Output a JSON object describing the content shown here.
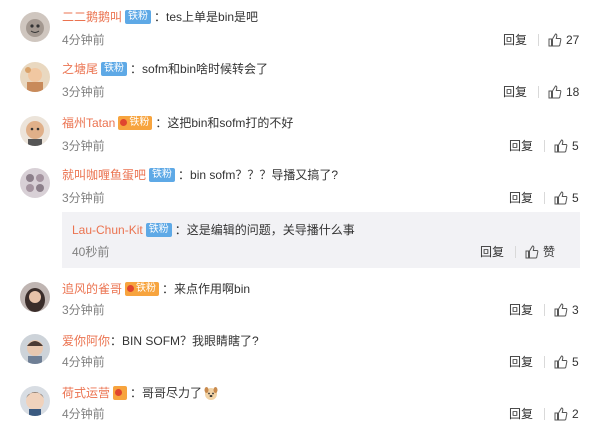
{
  "common": {
    "reply_label": "回复",
    "colon": "："
  },
  "comments": [
    {
      "username": "二二鹅鹅叫",
      "badge": "铁粉",
      "badge_type": "fan",
      "text": "tes上单是bin是吧",
      "time": "4分钟前",
      "likes": "27"
    },
    {
      "username": "之塘尾",
      "badge": "铁粉",
      "badge_type": "fan",
      "text": "sofm和bin啥时候转会了",
      "time": "3分钟前",
      "likes": "18"
    },
    {
      "username": "福州Tatan",
      "badge": "铁粉",
      "badge_type": "vip",
      "text": "这把bin和sofm打的不好",
      "time": "3分钟前",
      "likes": "5"
    },
    {
      "username": "就叫咖喱鱼蛋吧",
      "badge": "铁粉",
      "badge_type": "fan",
      "text": "bin sofm？？？导播又搞了?",
      "time": "3分钟前",
      "likes": "5",
      "subreply": {
        "username": "Lau-Chun-Kit",
        "badge": "铁粉",
        "badge_type": "fan",
        "text": "这是编辑的问题，关导播什么事",
        "time": "40秒前",
        "likes": "赞"
      }
    },
    {
      "username": "追风的雀哥",
      "badge": "铁粉",
      "badge_type": "vip",
      "text": "来点作用啊bin",
      "time": "3分钟前",
      "likes": "3"
    },
    {
      "username": "爱你阿你",
      "badge": "",
      "badge_type": "none",
      "text": "BIN SOFM？我眼睛瞎了?",
      "time": "4分钟前",
      "likes": "5"
    },
    {
      "username": "荷式运营",
      "badge": "",
      "badge_type": "vip-icon",
      "text": "哥哥尽力了",
      "time": "4分钟前",
      "likes": "2",
      "emoji": "dog-face-emoji"
    }
  ],
  "colors": {
    "username": "#eb7350",
    "fan_badge": "#5ea9e6",
    "vip_badge": "#f7a43e",
    "time": "#808080",
    "subreply_bg": "#f2f2f5"
  }
}
